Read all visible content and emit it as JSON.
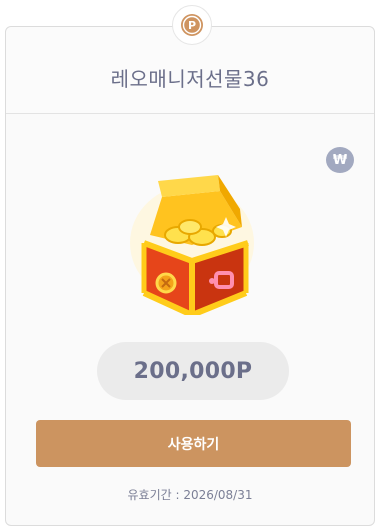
{
  "coupon": {
    "badge_letter": "P",
    "title": "레오매니저선물36",
    "currency_icon": "won-icon",
    "currency_symbol": "₩",
    "image": "treasure-chest-with-gold-coins",
    "points": "200,000P",
    "use_button_label": "사용하기",
    "expiry_text": "유효기간 : 2026/08/31"
  },
  "colors": {
    "accent": "#cc9460",
    "title_text": "#6b6f8a",
    "pill_bg": "#ebebeb",
    "won_icon_bg": "#a2a9c0"
  }
}
